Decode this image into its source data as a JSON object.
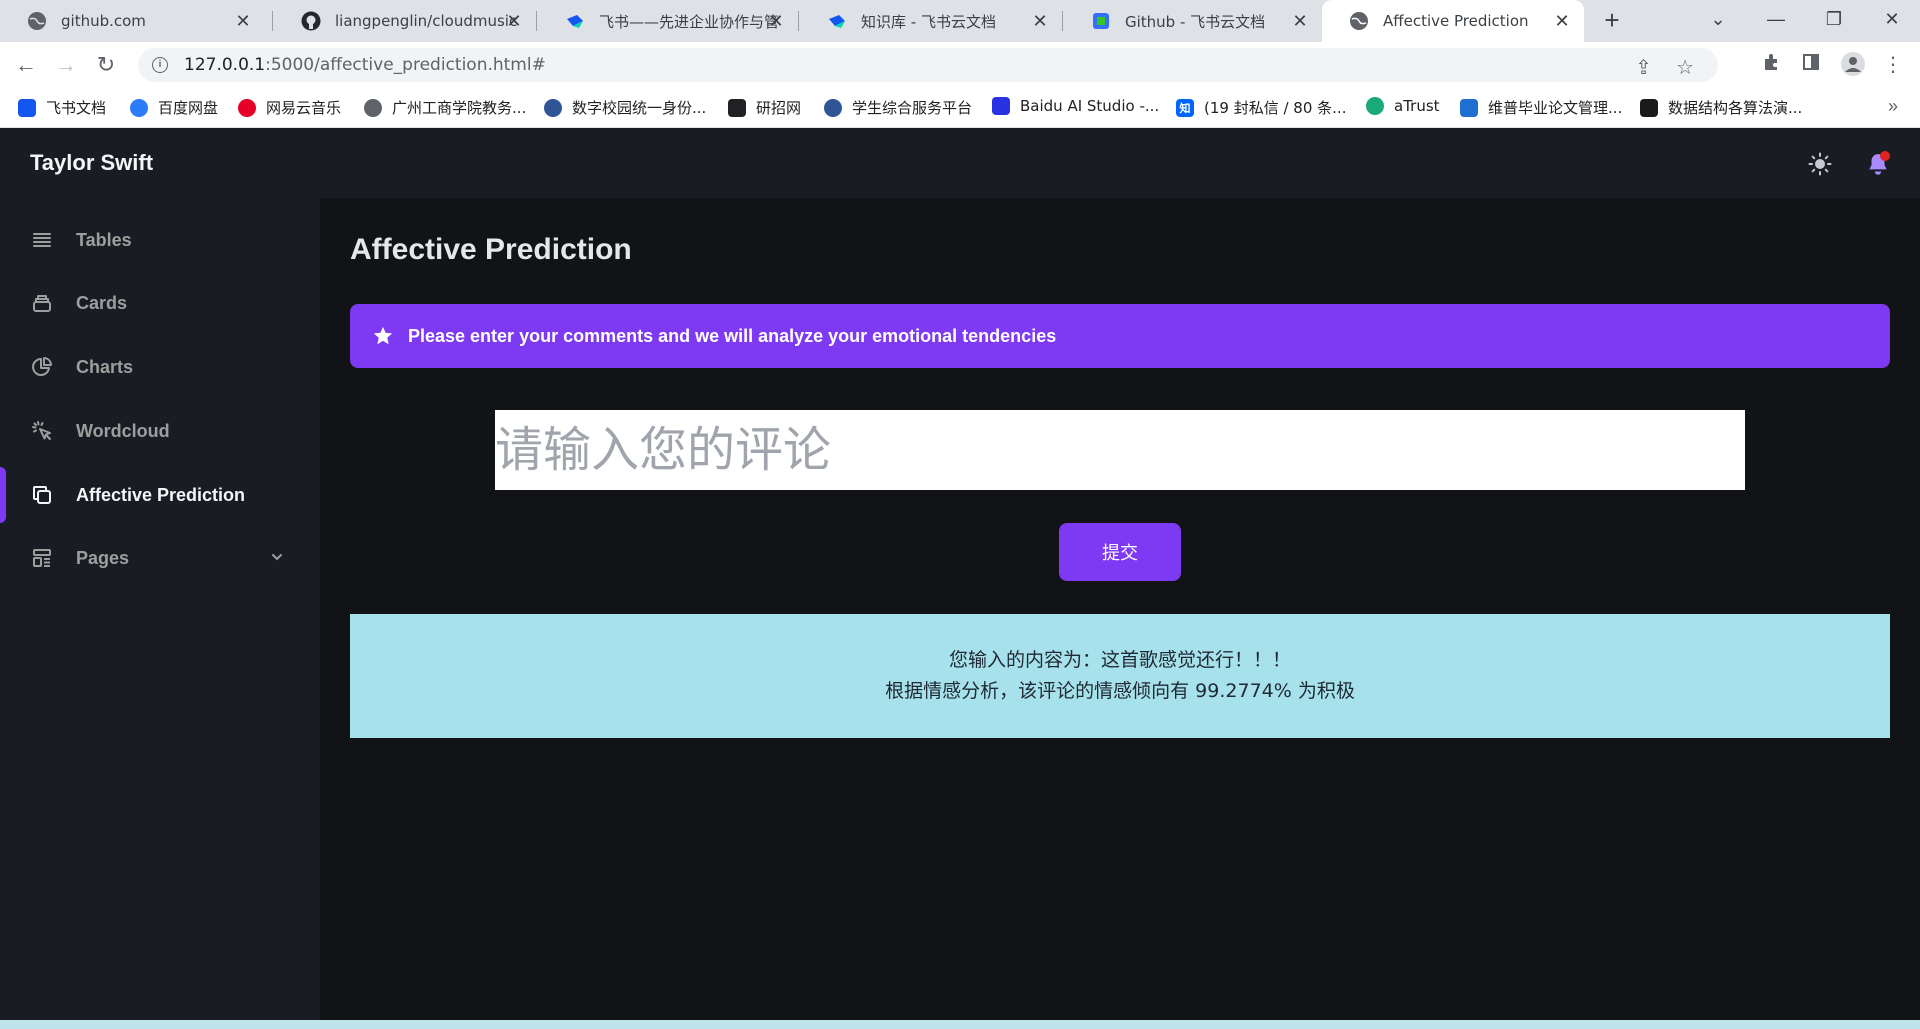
{
  "browser": {
    "tabs": [
      {
        "title": "github.com",
        "icon": "globe-icon"
      },
      {
        "title": "liangpenglin/cloudmusic",
        "icon": "github-icon"
      },
      {
        "title": "飞书——先进企业协作与管",
        "icon": "feishu-icon"
      },
      {
        "title": "知识库 - 飞书云文档",
        "icon": "feishu-icon"
      },
      {
        "title": "Github - 飞书云文档",
        "icon": "feishu-doc-icon"
      },
      {
        "title": "Affective Prediction",
        "icon": "globe-icon",
        "active": true
      }
    ],
    "url_host": "127.0.0.1",
    "url_rest": ":5000/affective_prediction.html#",
    "bookmarks": [
      {
        "label": "飞书文档",
        "color": "#1456f0"
      },
      {
        "label": "百度网盘",
        "color": "#2b7cf6"
      },
      {
        "label": "网易云音乐",
        "color": "#e60026"
      },
      {
        "label": "广州工商学院教务...",
        "color": "#5f6368"
      },
      {
        "label": "数字校园统一身份...",
        "color": "#2f5597"
      },
      {
        "label": "研招网",
        "color": "#202124"
      },
      {
        "label": "学生综合服务平台",
        "color": "#2f5597"
      },
      {
        "label": "Baidu AI Studio -...",
        "color": "#2932e1"
      },
      {
        "label": "(19 封私信 / 80 条...",
        "color": "#0066ff"
      },
      {
        "label": "aTrust",
        "color": "#1aa97b"
      },
      {
        "label": "维普毕业论文管理...",
        "color": "#1f6fd0"
      },
      {
        "label": "数据结构各算法演...",
        "color": "#1a1a1a"
      }
    ]
  },
  "app": {
    "brand": "Taylor Swift",
    "sidebar": [
      {
        "label": "Tables",
        "icon": "tables-icon"
      },
      {
        "label": "Cards",
        "icon": "cards-icon"
      },
      {
        "label": "Charts",
        "icon": "charts-icon"
      },
      {
        "label": "Wordcloud",
        "icon": "cursor-click-icon"
      },
      {
        "label": "Affective Prediction",
        "icon": "pages-copy-icon",
        "active": true
      },
      {
        "label": "Pages",
        "icon": "template-icon"
      }
    ],
    "page_title": "Affective Prediction",
    "alert_text": "Please enter your comments and we will analyze your emotional tendencies",
    "input_placeholder": "请输入您的评论",
    "input_value": "",
    "submit_label": "提交",
    "result_line1": "您输入的内容为：这首歌感觉还行！！！",
    "result_line2": "根据情感分析，该评论的情感倾向有 99.2774% 为积极"
  },
  "colors": {
    "accent": "#7e3af2",
    "result_bg": "#a7e1eb",
    "sidebar_bg": "#1a1c23",
    "main_bg": "#121317"
  }
}
